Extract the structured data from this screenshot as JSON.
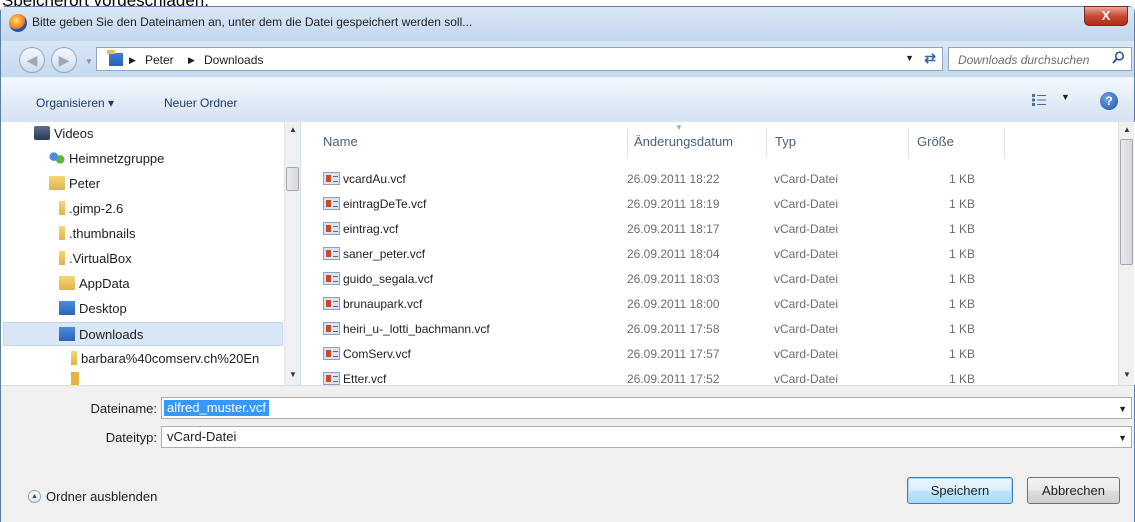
{
  "background_caption": "Speicherort vorgeschlagen.",
  "window": {
    "title": "Bitte geben Sie den Dateinamen an, unter dem die Datei gespeichert werden soll...",
    "close_label": "X"
  },
  "address": {
    "crumbs": [
      "Peter",
      "Downloads"
    ],
    "search_placeholder": "Downloads durchsuchen"
  },
  "toolbar": {
    "organize_label": "Organisieren ▾",
    "new_folder_label": "Neuer Ordner",
    "help_label": "?"
  },
  "nav_tree": [
    {
      "label": "Videos",
      "icon": "videos-icon"
    },
    {
      "label": "Heimnetzgruppe",
      "icon": "homegroup-icon"
    },
    {
      "label": "Peter",
      "icon": "user-folder-icon"
    },
    {
      "label": ".gimp-2.6",
      "icon": "folder-icon"
    },
    {
      "label": ".thumbnails",
      "icon": "folder-icon"
    },
    {
      "label": ".VirtualBox",
      "icon": "folder-icon"
    },
    {
      "label": "AppData",
      "icon": "folder-icon"
    },
    {
      "label": "Desktop",
      "icon": "desktop-folder-icon"
    },
    {
      "label": "Downloads",
      "icon": "downloads-folder-icon",
      "selected": true
    },
    {
      "label": "barbara%40comserv.ch%20En",
      "icon": "folder-icon"
    }
  ],
  "file_list": {
    "columns": [
      "Name",
      "Änderungsdatum",
      "Typ",
      "Größe"
    ],
    "rows": [
      {
        "name": "vcardAu.vcf",
        "date": "26.09.2011 18:22",
        "type": "vCard-Datei",
        "size": "1 KB"
      },
      {
        "name": "eintragDeTe.vcf",
        "date": "26.09.2011 18:19",
        "type": "vCard-Datei",
        "size": "1 KB"
      },
      {
        "name": "eintrag.vcf",
        "date": "26.09.2011 18:17",
        "type": "vCard-Datei",
        "size": "1 KB"
      },
      {
        "name": "saner_peter.vcf",
        "date": "26.09.2011 18:04",
        "type": "vCard-Datei",
        "size": "1 KB"
      },
      {
        "name": "guido_segala.vcf",
        "date": "26.09.2011 18:03",
        "type": "vCard-Datei",
        "size": "1 KB"
      },
      {
        "name": "brunaupark.vcf",
        "date": "26.09.2011 18:00",
        "type": "vCard-Datei",
        "size": "1 KB"
      },
      {
        "name": "heiri_u-_lotti_bachmann.vcf",
        "date": "26.09.2011 17:58",
        "type": "vCard-Datei",
        "size": "1 KB"
      },
      {
        "name": "ComServ.vcf",
        "date": "26.09.2011 17:57",
        "type": "vCard-Datei",
        "size": "1 KB"
      },
      {
        "name": "Etter.vcf",
        "date": "26.09.2011 17:52",
        "type": "vCard-Datei",
        "size": "1 KB"
      }
    ]
  },
  "form": {
    "filename_label": "Dateiname:",
    "filename_value": "alfred_muster.vcf",
    "filetype_label": "Dateityp:",
    "filetype_value": "vCard-Datei"
  },
  "footer": {
    "hide_folders_label": "Ordner ausblenden",
    "save_label": "Speichern",
    "cancel_label": "Abbrechen"
  },
  "colors": {
    "selection": "#3399ff",
    "frame": "#c6d9ef",
    "close": "#c74a34"
  }
}
